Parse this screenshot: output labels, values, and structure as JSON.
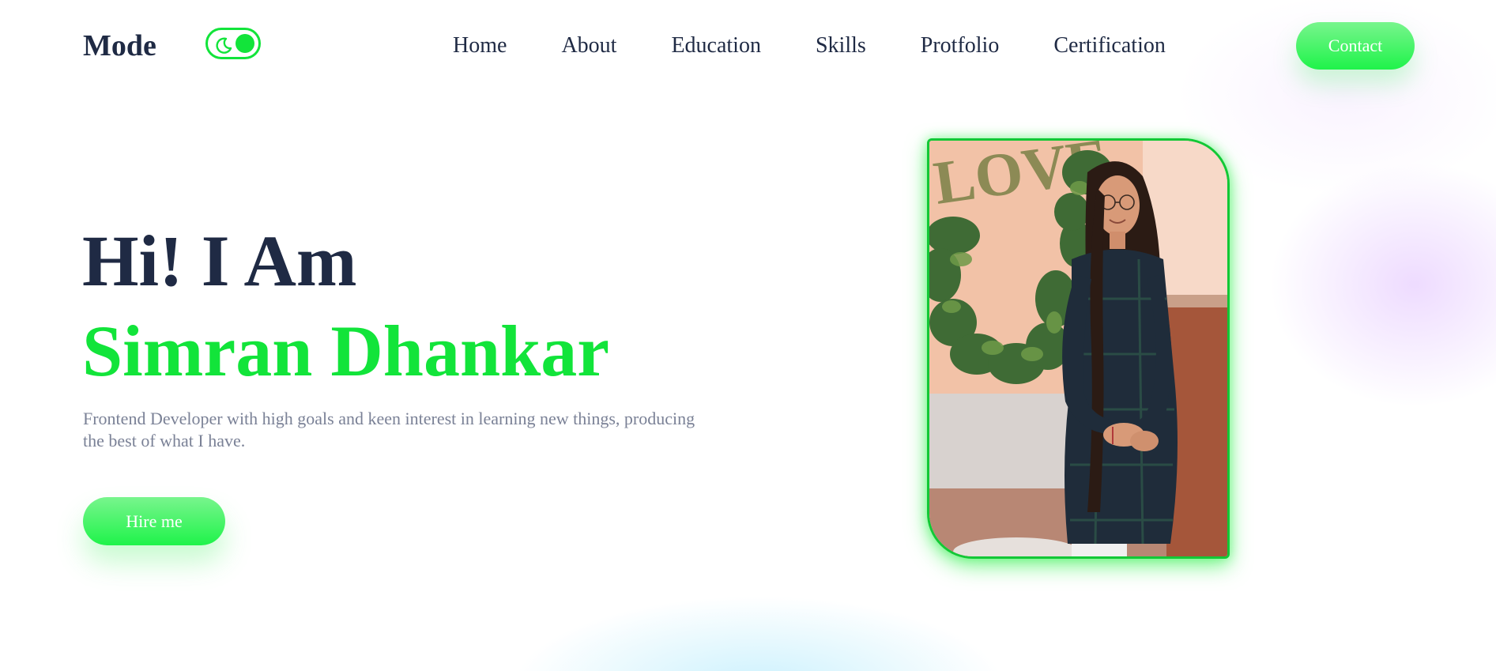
{
  "header": {
    "brand": "Mode",
    "mode_toggle_icon": "moon-icon",
    "nav": [
      "Home",
      "About",
      "Education",
      "Skills",
      "Protfolio",
      "Certification"
    ],
    "contact_label": "Contact"
  },
  "hero": {
    "greeting": "Hi! I Am",
    "name": "Simran Dhankar",
    "tagline": "Frontend Developer with high goals and keen interest in learning new things, producing the best of what I have.",
    "hire_label": "Hire me",
    "photo_sign_text": "LOVE"
  },
  "colors": {
    "accent": "#12e43a",
    "heading": "#1f2a44",
    "muted_text": "#7a8196"
  }
}
